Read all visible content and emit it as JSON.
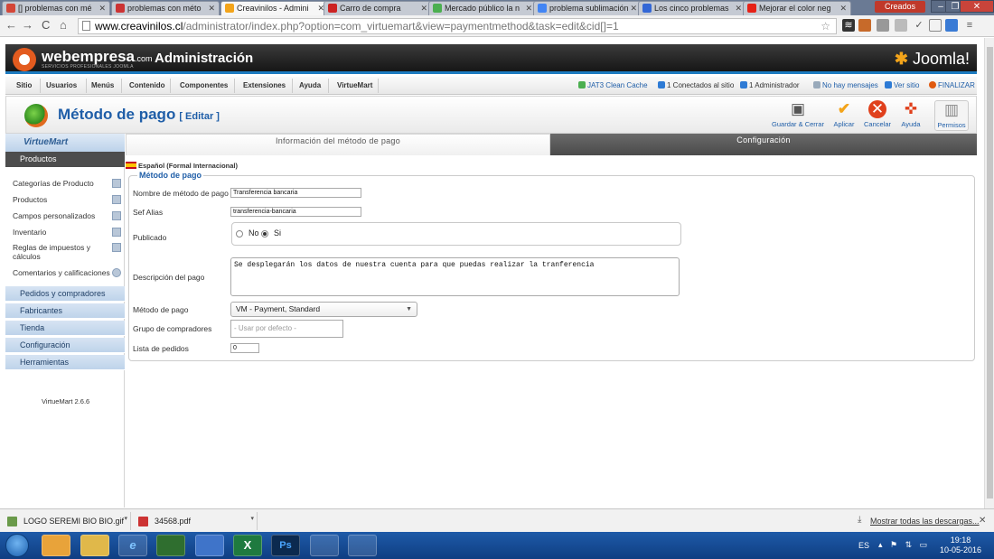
{
  "browser": {
    "tabs": [
      {
        "title": "[] problemas con mé",
        "color": "#d44638"
      },
      {
        "title": "problemas con méto",
        "color": "#cc3333"
      },
      {
        "title": "Creavinilos - Admini",
        "color": "#f3a41a"
      },
      {
        "title": "Carro de compra",
        "color": "#cc2222"
      },
      {
        "title": "Mercado público la n",
        "color": "#4caf50"
      },
      {
        "title": "problema sublimación",
        "color": "#4285f4"
      },
      {
        "title": "Los cinco problemas",
        "color": "#3367d6"
      },
      {
        "title": "Mejorar el color neg",
        "color": "#e62117"
      }
    ],
    "user_badge": "Creados",
    "url_host": "www.creavinilos.cl",
    "url_path": "/administrator/index.php?option=com_virtuemart&view=paymentmethod&task=edit&cid[]=1"
  },
  "header": {
    "brand": "webempresa",
    "brand_tld": ".com",
    "brand_sub": "SERVICIOS PROFESIONALES JOOMLA",
    "title": "Administración",
    "joomla": "Joomla!"
  },
  "menu": {
    "items": [
      "Sitio",
      "Usuarios",
      "Menús",
      "Contenido",
      "Componentes",
      "Extensiones",
      "Ayuda",
      "VirtueMart"
    ],
    "status": {
      "cache": "JAT3 Clean Cache",
      "connected": "1 Conectados al sitio",
      "admins": "1 Administrador",
      "messages": "No hay mensajes",
      "view_site": "Ver sitio",
      "logout": "FINALIZAR"
    }
  },
  "page": {
    "title": "Método de pago",
    "subtitle": "[ Editar ]",
    "toolbar": {
      "save_close": "Guardar & Cerrar",
      "apply": "Aplicar",
      "cancel": "Cancelar",
      "help": "Ayuda",
      "permissions": "Permisos"
    }
  },
  "sidebar": {
    "logo": "VirtueMart",
    "active_section": "Productos",
    "items": [
      "Categorías de Producto",
      "Productos",
      "Campos personalizados",
      "Inventario",
      "Reglas de impuestos y cálculos",
      "Comentarios y calificaciones"
    ],
    "sections": [
      "Pedidos y compradores",
      "Fabricantes",
      "Tienda",
      "Configuración",
      "Herramientas"
    ],
    "version": "VirtueMart 2.6.6"
  },
  "tabs": {
    "info": "Información del método de pago",
    "config": "Configuración"
  },
  "form": {
    "language": "Español (Formal Internacional)",
    "legend": "Método de pago",
    "name_label": "Nombre de método de pago",
    "name_value": "Transferencia bancaria",
    "alias_label": "Sef Alias",
    "alias_value": "transferencia-bancaria",
    "published_label": "Publicado",
    "published_no": "No",
    "published_yes": "Si",
    "published_value": "Si",
    "description_label": "Descripción del pago",
    "description_value": "Se desplegarán los datos de nuestra cuenta para que puedas realizar la tranferencia",
    "method_label": "Método de pago",
    "method_value": "VM - Payment, Standard",
    "group_label": "Grupo de compradores",
    "group_placeholder": "- Usar por defecto -",
    "order_label": "Lista de pedidos",
    "order_value": "0"
  },
  "downloads": {
    "items": [
      "LOGO SEREMI BIO BIO.gif",
      "34568.pdf"
    ],
    "show_all": "Mostrar todas las descargas..."
  },
  "taskbar": {
    "apps": [
      "",
      "",
      "",
      "e",
      "",
      "",
      "X",
      "Ps",
      "",
      ""
    ],
    "lang": "ES",
    "time": "19:18",
    "date": "10-05-2016"
  }
}
